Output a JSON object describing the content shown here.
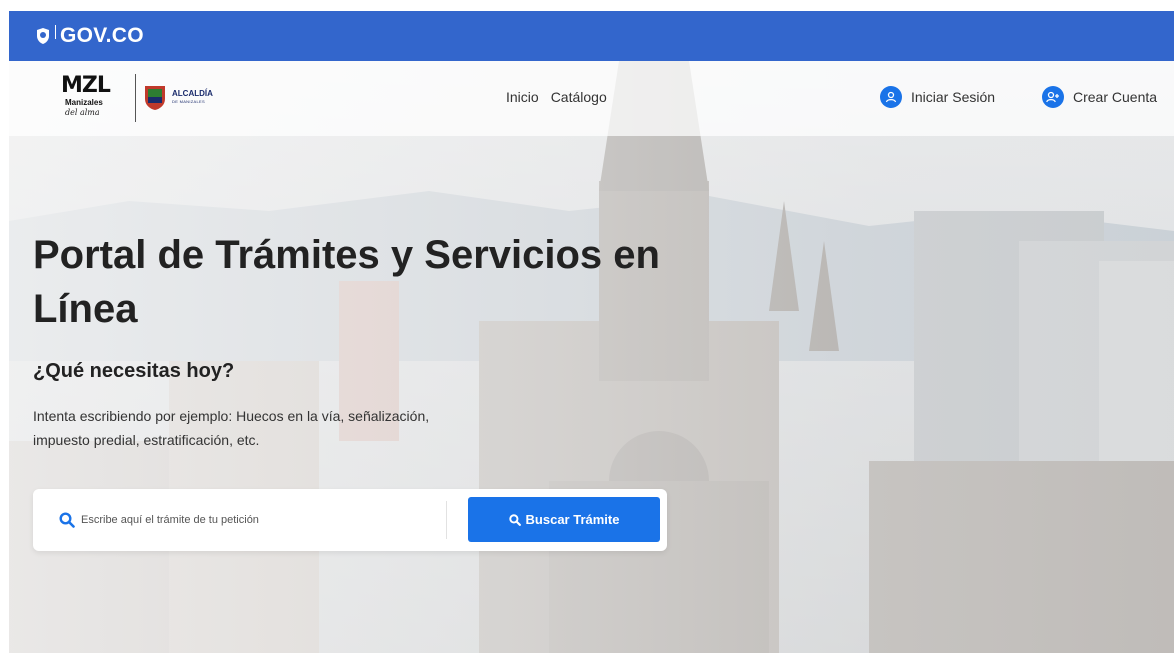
{
  "gov_bar": {
    "logo_text": "GOV.CO",
    "color": "#3366cc"
  },
  "brand": {
    "mzl": "MZL",
    "mzl_sub": "Manizales",
    "mzl_script": "del alma",
    "alcaldia": "ALCALDÍA",
    "alcaldia_sub": "DE MANIZALES"
  },
  "nav": {
    "items": [
      {
        "label": "Inicio"
      },
      {
        "label": "Catálogo"
      }
    ]
  },
  "account": {
    "login_label": "Iniciar Sesión",
    "signup_label": "Crear Cuenta",
    "accent": "#1a73e8"
  },
  "hero": {
    "title": "Portal de Trámites y Servicios en Línea",
    "subtitle": "¿Qué necesitas hoy?",
    "hint": "Intenta escribiendo por ejemplo: Huecos en la vía, señalización, impuesto predial, estratificación, etc."
  },
  "search": {
    "placeholder": "Escribe aquí el trámite de tu petición",
    "value": "",
    "button_label": "Buscar Trámite",
    "icon": "search-icon"
  }
}
